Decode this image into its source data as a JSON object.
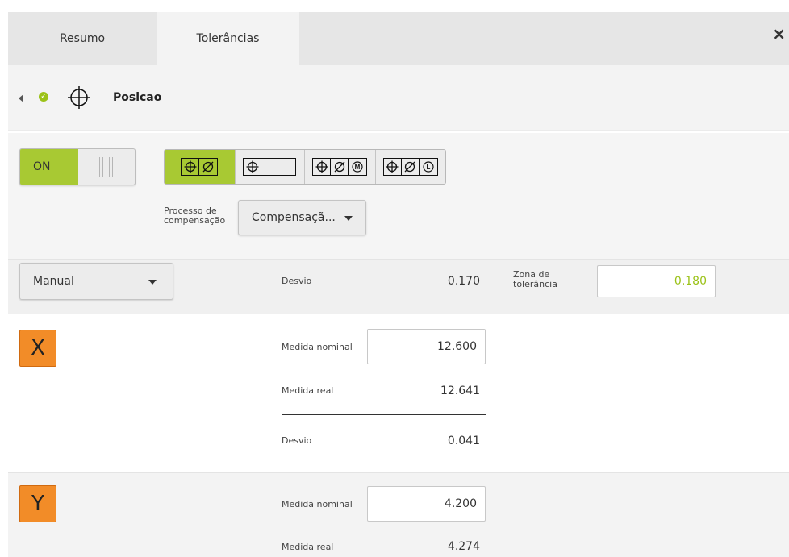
{
  "tabs": [
    {
      "label": "Resumo",
      "active": false
    },
    {
      "label": "Tolerâncias",
      "active": true
    }
  ],
  "close_glyph": "×",
  "header": {
    "title": "Posicao",
    "back_icon": "chevron-left-icon",
    "status_icon": "check-circle-icon",
    "feature_icon": "position-symbol-icon"
  },
  "toggle": {
    "label": "ON",
    "state": "on"
  },
  "tolerance_types": [
    {
      "symbols": [
        "⌖",
        "Ø"
      ],
      "selected": true
    },
    {
      "symbols": [
        "⌖",
        ""
      ],
      "selected": false
    },
    {
      "symbols": [
        "⌖",
        "Ø",
        "M"
      ],
      "selected": false
    },
    {
      "symbols": [
        "⌖",
        "Ø",
        "L"
      ],
      "selected": false
    }
  ],
  "compensation": {
    "label": "Processo de compensação",
    "selected": "Compensaçã..."
  },
  "method": {
    "selected": "Manual"
  },
  "deviation": {
    "label": "Desvio",
    "value": "0.170"
  },
  "tolerance_zone": {
    "label": "Zona de tolerância",
    "value": "0.180"
  },
  "axes": [
    {
      "name": "X",
      "nominal_label": "Medida nominal",
      "nominal": "12.600",
      "actual_label": "Medida real",
      "actual": "12.641",
      "deviation_label": "Desvio",
      "deviation": "0.041"
    },
    {
      "name": "Y",
      "nominal_label": "Medida nominal",
      "nominal": "4.200",
      "actual_label": "Medida real",
      "actual": "4.274"
    }
  ],
  "colors": {
    "accent_green": "#a8c933",
    "tolerance_value": "#9bc218",
    "axis_badge": "#f28c28"
  }
}
